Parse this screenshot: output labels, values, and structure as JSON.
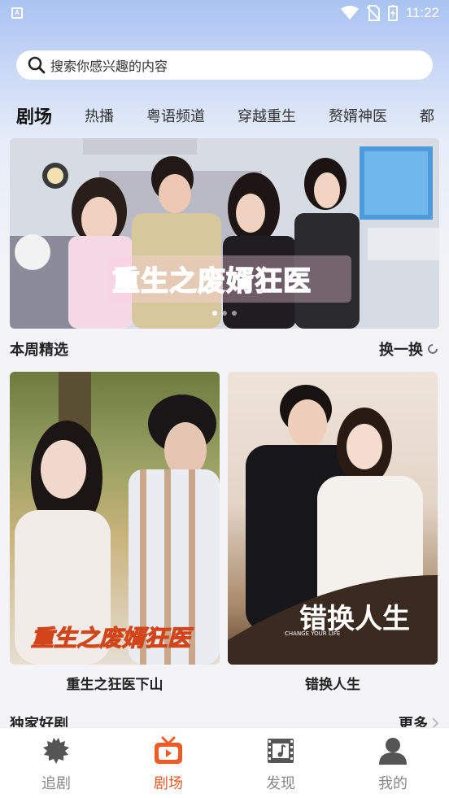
{
  "status_bar": {
    "time": "11:22",
    "app_badge": "A"
  },
  "search": {
    "placeholder": "搜索你感兴趣的内容"
  },
  "tabs": [
    {
      "label": "剧场",
      "active": true
    },
    {
      "label": "热播"
    },
    {
      "label": "粤语频道"
    },
    {
      "label": "穿越重生"
    },
    {
      "label": "赘婿神医"
    },
    {
      "label": "都"
    }
  ],
  "banner": {
    "title": "重生之废婿狂医",
    "dots": 3,
    "active_dot": 0
  },
  "weekly": {
    "title": "本周精选",
    "action": "换一换",
    "items": [
      {
        "title": "重生之狂医下山",
        "poster_text": "重生之废婿狂医"
      },
      {
        "title": "错换人生",
        "poster_text": "错换人生",
        "poster_subtext": "CHANGE YOUR LIFE"
      }
    ]
  },
  "exclusive": {
    "title": "独家好剧",
    "action": "更多"
  },
  "nav": [
    {
      "label": "追剧",
      "icon": "star-burst-icon",
      "active": false
    },
    {
      "label": "剧场",
      "icon": "tv-icon",
      "active": true
    },
    {
      "label": "发现",
      "icon": "film-music-icon",
      "active": false
    },
    {
      "label": "我的",
      "icon": "user-icon",
      "active": false
    }
  ],
  "colors": {
    "accent": "#ef5a27",
    "banner_title": "#ff3e8e"
  }
}
